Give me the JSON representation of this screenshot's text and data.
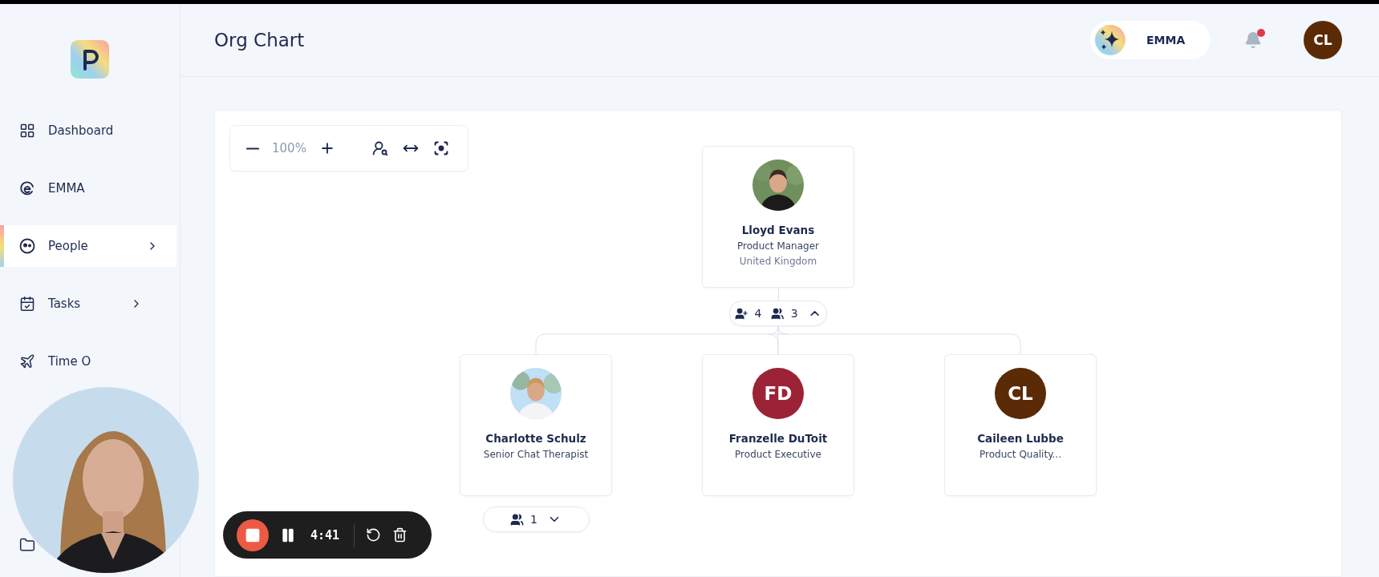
{
  "sidebar": {
    "items": [
      {
        "label": "Dashboard",
        "selected": false,
        "has_submenu": false
      },
      {
        "label": "EMMA",
        "selected": false,
        "has_submenu": false
      },
      {
        "label": "People",
        "selected": true,
        "has_submenu": true
      },
      {
        "label": "Tasks",
        "selected": false,
        "has_submenu": true
      },
      {
        "label": "Time O",
        "selected": false,
        "has_submenu": false
      }
    ]
  },
  "header": {
    "title": "Org Chart",
    "assistant": {
      "label": "EMMA"
    },
    "notifications": {
      "unread": true
    },
    "user": {
      "initials": "CL",
      "color": "#5b2a06"
    }
  },
  "toolbar": {
    "zoom": "100%"
  },
  "org_chart": {
    "root": {
      "name": "Lloyd Evans",
      "role": "Product Manager",
      "location": "United Kingdom",
      "counts": {
        "total": "4",
        "direct": "3",
        "expanded": true
      }
    },
    "children": [
      {
        "name": "Charlotte Schulz",
        "role": "Senior Chat Therapist",
        "counts": {
          "direct": "1",
          "expanded": false
        }
      },
      {
        "name": "Franzelle DuToit",
        "role": "Product Executive",
        "avatar": {
          "kind": "initials",
          "initials": "FD",
          "color": "#9b2335"
        }
      },
      {
        "name": "Caileen Lubbe",
        "role": "Product Quality...",
        "avatar": {
          "kind": "initials",
          "initials": "CL",
          "color": "#5b2a06"
        }
      }
    ]
  },
  "recorder": {
    "time": "4:41"
  }
}
